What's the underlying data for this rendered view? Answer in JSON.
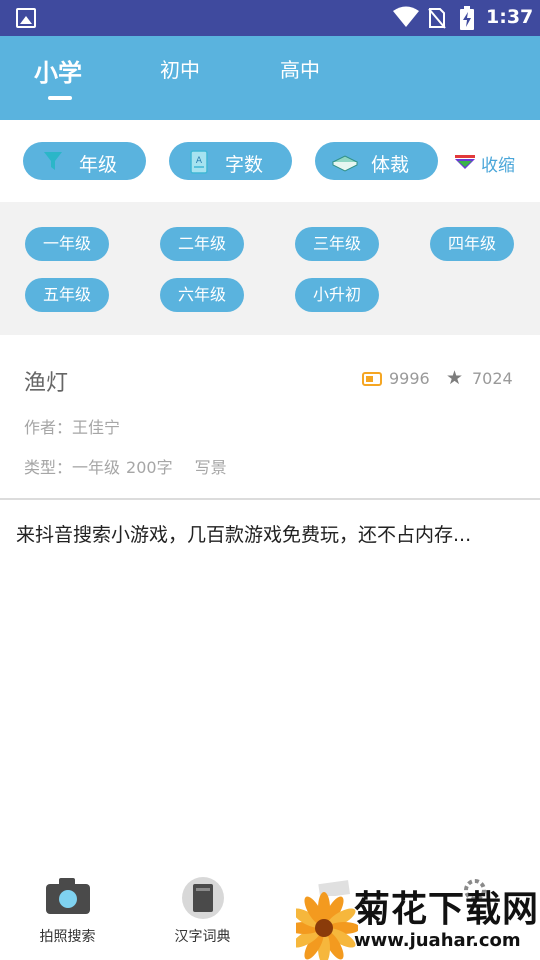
{
  "status_bar": {
    "time": "1:37"
  },
  "tabs": [
    {
      "label": "小学",
      "active": true
    },
    {
      "label": "初中",
      "active": false
    },
    {
      "label": "高中",
      "active": false
    }
  ],
  "filters": [
    {
      "label": "年级",
      "icon": "filter-icon"
    },
    {
      "label": "字数",
      "icon": "document-icon"
    },
    {
      "label": "体裁",
      "icon": "book-icon"
    }
  ],
  "collapse_label": "收缩",
  "grades": [
    "一年级",
    "二年级",
    "三年级",
    "四年级",
    "五年级",
    "六年级",
    "小升初"
  ],
  "essay": {
    "title": "渔灯",
    "views": "9996",
    "favorites": "7024",
    "author": "作者：王佳宁",
    "type_label": "类型：",
    "grade": "一年级",
    "words": "200字",
    "genre": "写景"
  },
  "ad_text": "来抖音搜索小游戏，几百款游戏免费玩，还不占内存...",
  "bottom_nav": [
    {
      "label": "拍照搜索",
      "icon": "camera-icon"
    },
    {
      "label": "汉字词典",
      "icon": "dictionary-icon"
    },
    {
      "label": "",
      "icon": "essay-icon"
    },
    {
      "label": "",
      "icon": "settings-icon"
    }
  ],
  "watermark": {
    "title": "菊花下载网",
    "url": "www.juahar.com"
  },
  "colors": {
    "status_bar": "#3f4a9e",
    "primary": "#5ab3de",
    "panel_bg": "#f2f2f2",
    "views_icon": "#f5a623"
  }
}
